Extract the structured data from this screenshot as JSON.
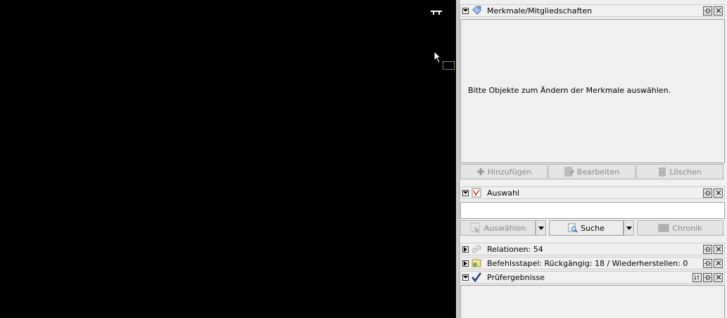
{
  "properties_panel": {
    "title": "Merkmale/Mitgliedschaften",
    "empty_message": "Bitte Objekte zum Ändern der Merkmale auswählen.",
    "buttons": {
      "add": "Hinzufügen",
      "edit": "Bearbeiten",
      "delete": "Löschen"
    }
  },
  "selection_panel": {
    "title": "Auswahl",
    "buttons": {
      "select": "Auswählen",
      "search": "Suche",
      "history": "Chronik"
    }
  },
  "relations_panel": {
    "title": "Relationen: 54"
  },
  "command_stack_panel": {
    "title": "Befehlsstapel: Rückgängig: 18 / Wiederherstellen: 0"
  },
  "validation_panel": {
    "title": "Prüfergebnisse"
  },
  "icons": {
    "collapse": "triangle-down-icon",
    "expand": "triangle-right-icon",
    "pin": "pin-icon",
    "close": "close-icon"
  }
}
